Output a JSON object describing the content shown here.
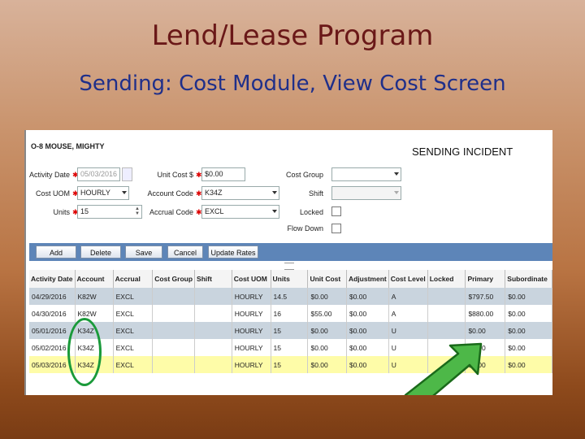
{
  "slide": {
    "title": "Lend/Lease Program",
    "subtitle": "Sending: Cost Module, View Cost Screen"
  },
  "screen": {
    "person": "O-8  MOUSE, MIGHTY",
    "banner": "SENDING INCIDENT",
    "form": {
      "activity_date": {
        "label": "Activity Date",
        "value": "05/03/2016"
      },
      "cost_uom": {
        "label": "Cost UOM",
        "value": "HOURLY"
      },
      "units": {
        "label": "Units",
        "value": "15"
      },
      "unit_cost": {
        "label": "Unit Cost $",
        "value": "$0.00"
      },
      "account_code": {
        "label": "Account Code",
        "value": "K34Z"
      },
      "accrual_code": {
        "label": "Accrual Code",
        "value": "EXCL"
      },
      "cost_group": {
        "label": "Cost Group",
        "value": ""
      },
      "shift": {
        "label": "Shift",
        "value": ""
      },
      "locked": {
        "label": "Locked"
      },
      "flow_down": {
        "label": "Flow Down"
      }
    },
    "toolbar": {
      "add": "Add",
      "delete": "Delete",
      "save": "Save",
      "cancel": "Cancel",
      "update_rates": "Update Rates"
    },
    "grid": {
      "columns": [
        "Activity Date",
        "Account",
        "Accrual",
        "Cost Group",
        "Shift",
        "Cost UOM",
        "Units",
        "Unit Cost",
        "Adjustment",
        "Cost Level",
        "Locked",
        "Primary",
        "Subordinate"
      ],
      "rows": [
        [
          "04/29/2016",
          "K82W",
          "EXCL",
          "",
          "",
          "HOURLY",
          "14.5",
          "$0.00",
          "$0.00",
          "A",
          "",
          "$797.50",
          "$0.00"
        ],
        [
          "04/30/2016",
          "K82W",
          "EXCL",
          "",
          "",
          "HOURLY",
          "16",
          "$55.00",
          "$0.00",
          "A",
          "",
          "$880.00",
          "$0.00"
        ],
        [
          "05/01/2016",
          "K34Z",
          "EXCL",
          "",
          "",
          "HOURLY",
          "15",
          "$0.00",
          "$0.00",
          "U",
          "",
          "$0.00",
          "$0.00"
        ],
        [
          "05/02/2016",
          "K34Z",
          "EXCL",
          "",
          "",
          "HOURLY",
          "15",
          "$0.00",
          "$0.00",
          "U",
          "",
          "$0.00",
          "$0.00"
        ],
        [
          "05/03/2016",
          "K34Z",
          "EXCL",
          "",
          "",
          "HOURLY",
          "15",
          "$0.00",
          "$0.00",
          "U",
          "",
          "$0.00",
          "$0.00"
        ]
      ]
    }
  },
  "colors": {
    "title": "#6a1818",
    "subtitle": "#1f2f8a",
    "toolbar": "#5d85b8",
    "row_alt": "#c9d4de",
    "row_selected": "#fefca8",
    "annotation": "#1a9a3a"
  }
}
